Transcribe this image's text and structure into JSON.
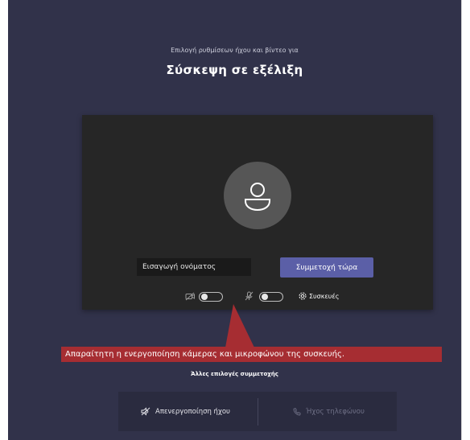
{
  "header": {
    "subtitle": "Επιλογή ρυθμίσεων ήχου και βίντεο για",
    "title": "Σύσκεψη σε εξέλιξη"
  },
  "preview": {
    "name_placeholder": "Εισαγωγή ονόματος",
    "join_label": "Συμμετοχή τώρα",
    "devices_label": "Συσκευές",
    "camera_toggle": "off",
    "mic_toggle": "off"
  },
  "callout": {
    "text": "Απαραίτητη η ενεργοποίηση κάμερας και μικροφώνου της συσκευής."
  },
  "other_options": {
    "heading": "Άλλες επιλογές συμμετοχής",
    "audio_off_label": "Απενεργοποίηση ήχου",
    "phone_audio_label": "Ήχος τηλεφώνου"
  },
  "colors": {
    "background": "#31324a",
    "preview": "#262626",
    "accent": "#5b5fa7",
    "callout": "#a62d32"
  }
}
